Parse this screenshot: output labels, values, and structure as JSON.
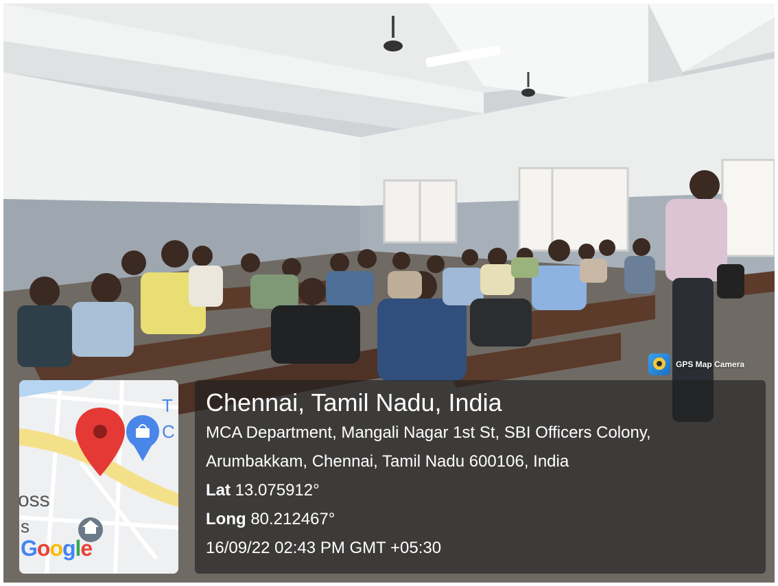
{
  "watermark": {
    "app_name": "GPS Map Camera",
    "app_icon": "gps-map-camera-icon"
  },
  "location": {
    "title": "Chennai, Tamil Nadu, India",
    "address_line1": "MCA Department, Mangali Nagar 1st St, SBI Officers Colony,",
    "address_line2": "Arumbakkam, Chennai, Tamil Nadu 600106, India",
    "lat_label": "Lat",
    "lat_value": "13.075912°",
    "long_label": "Long",
    "long_value": "80.212467°",
    "datetime": "16/09/22 02:43 PM GMT +05:30"
  },
  "map": {
    "pin_icon": "location-pin-icon",
    "shop_icon": "shopping-bag-pin-icon",
    "fragment_letter_1": "T",
    "fragment_letter_2": "C",
    "fragment_text_1": "oss",
    "fragment_text_2": "s",
    "logo_text": "Google",
    "colors": {
      "pin": "#e53935",
      "shop": "#4a86e8",
      "road": "#f5e08a"
    }
  }
}
